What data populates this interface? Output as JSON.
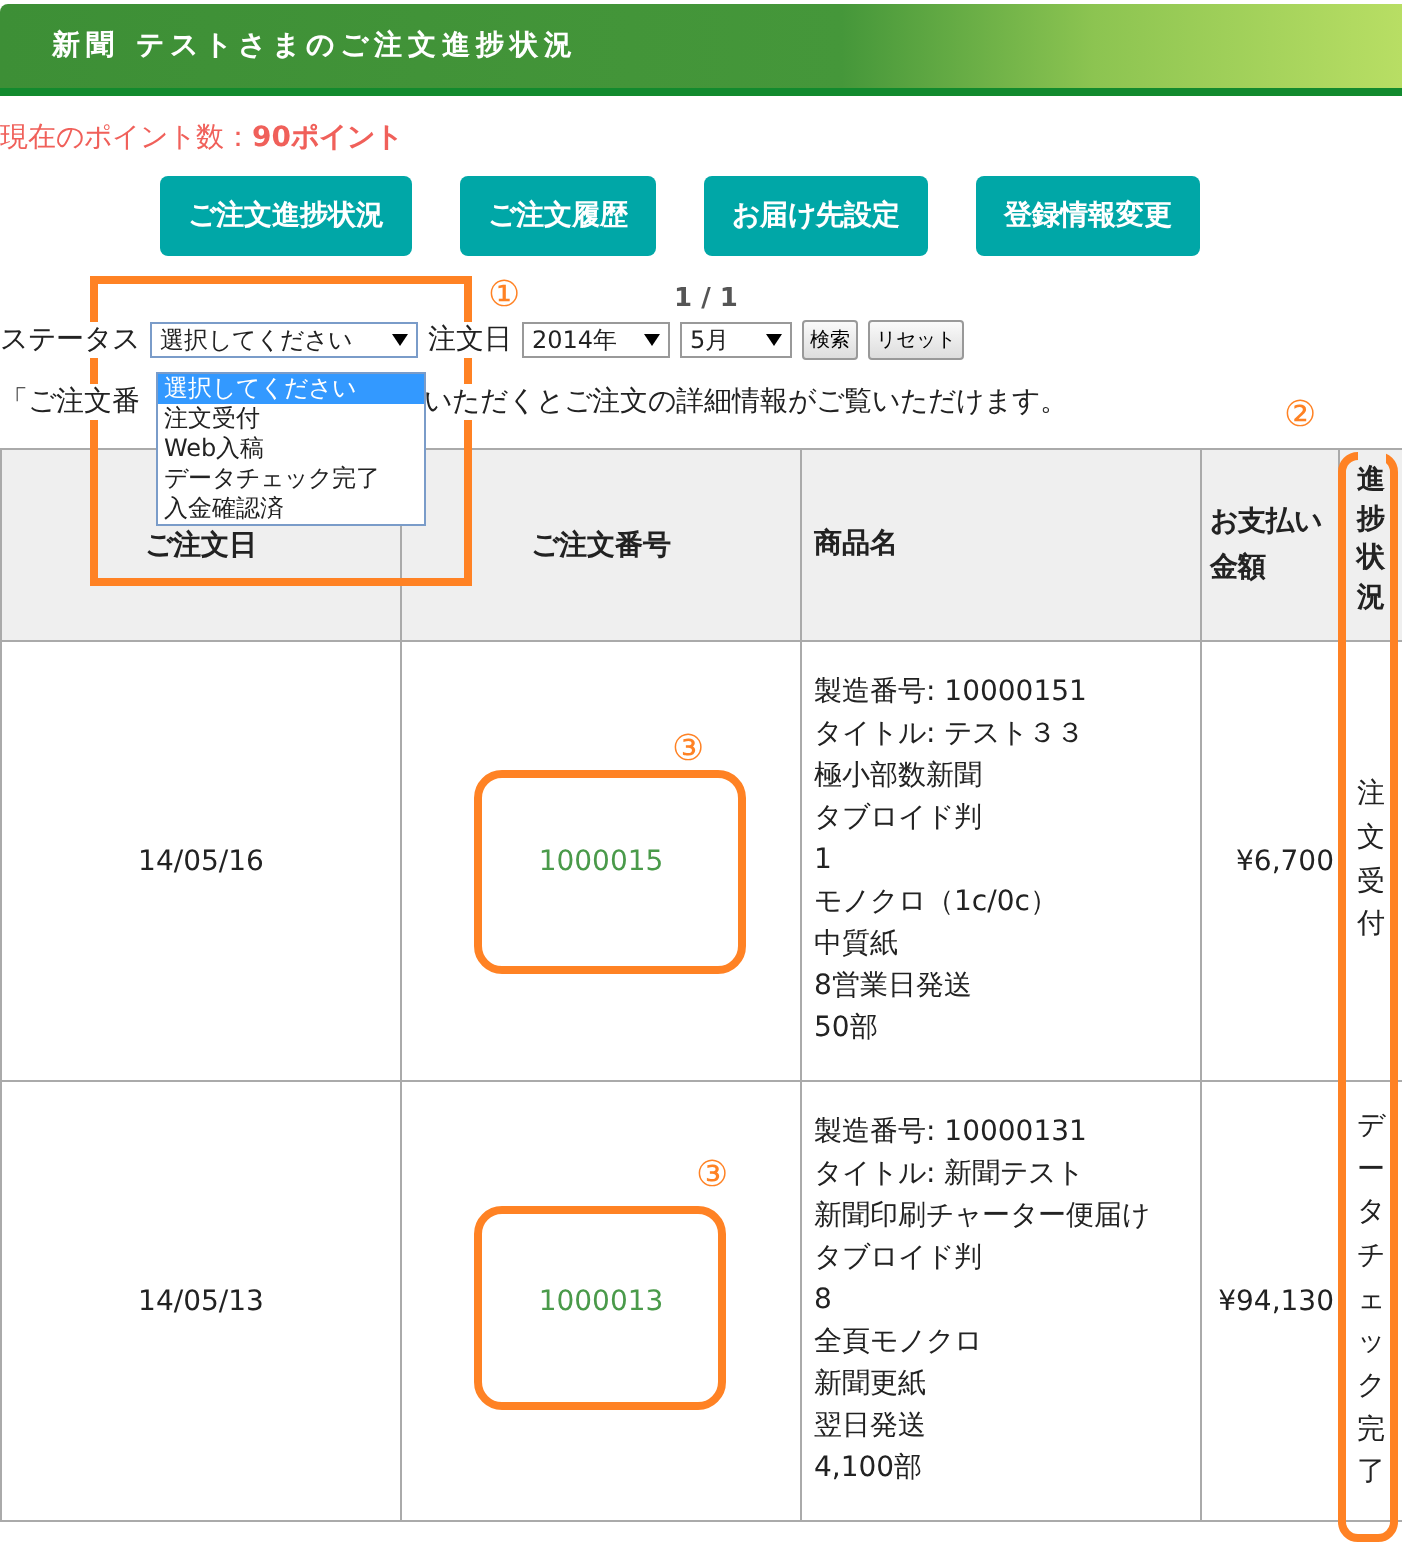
{
  "header": {
    "title": "新聞 テストさまのご注文進捗状況"
  },
  "points": {
    "label": "現在のポイント数：",
    "value": "90ポイント"
  },
  "nav_buttons": [
    {
      "label": "ご注文進捗状況"
    },
    {
      "label": "ご注文履歴"
    },
    {
      "label": "お届け先設定"
    },
    {
      "label": "登録情報変更"
    }
  ],
  "pagination": "1 / 1",
  "filters": {
    "status_label": "ステータス",
    "status_value": "選択してください",
    "status_options": [
      {
        "label": "選択してください",
        "selected": true
      },
      {
        "label": "注文受付",
        "selected": false
      },
      {
        "label": "Web入稿",
        "selected": false
      },
      {
        "label": "データチェック完了",
        "selected": false
      },
      {
        "label": "入金確認済",
        "selected": false
      }
    ],
    "date_label": "注文日",
    "year": "2014年",
    "month": "5月",
    "buttons": [
      "検索",
      "リセット"
    ]
  },
  "note": {
    "before": "「ご注文番",
    "after": "いただくとご注文の詳細情報がご覧いただけます。"
  },
  "table": {
    "columns": [
      "ご注文日",
      "ご注文番号",
      "商品名",
      "お支払い金額",
      "進捗状況"
    ],
    "rows": [
      {
        "date": "14/05/16",
        "order_no": "1000015",
        "product": [
          "製造番号: 10000151",
          "タイトル: テスト３３",
          "極小部数新聞",
          "タブロイド判",
          "1",
          "モノクロ（1c/0c）",
          "中質紙",
          "8営業日発送",
          "50部"
        ],
        "amount": "¥6,700",
        "status": "注文受付"
      },
      {
        "date": "14/05/13",
        "order_no": "1000013",
        "product": [
          "製造番号: 10000131",
          "タイトル: 新聞テスト",
          "新聞印刷チャーター便届け",
          "タブロイド判",
          "8",
          "全頁モノクロ",
          "新聞更紙",
          "翌日発送",
          "4,100部"
        ],
        "amount": "¥94,130",
        "status": "データチェック完了"
      }
    ]
  },
  "annotations": [
    "①",
    "②",
    "③",
    "③"
  ]
}
